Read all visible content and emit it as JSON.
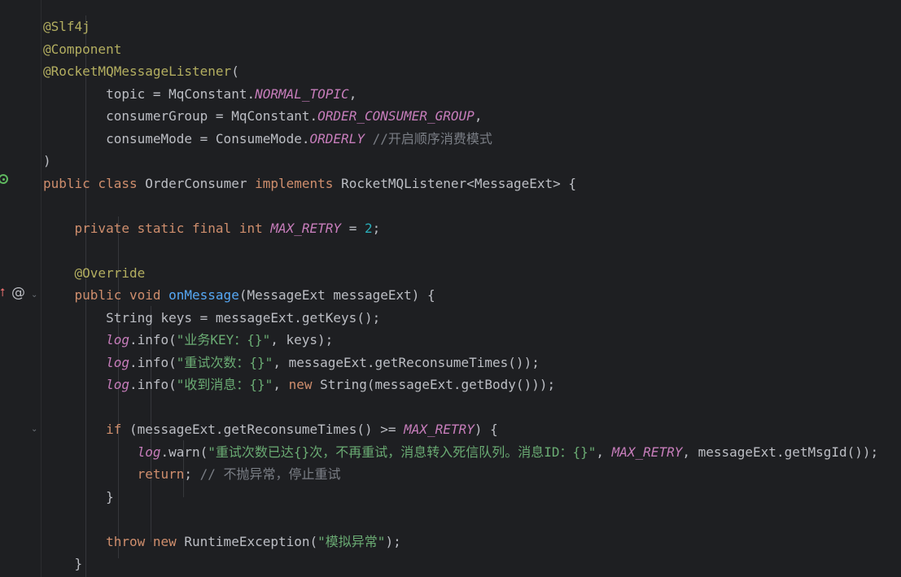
{
  "code": {
    "lines": [
      {
        "tokens": [
          {
            "c": "ann",
            "t": "@Slf4j"
          }
        ]
      },
      {
        "tokens": [
          {
            "c": "ann",
            "t": "@Component"
          }
        ]
      },
      {
        "tokens": [
          {
            "c": "ann",
            "t": "@RocketMQMessageListener"
          },
          {
            "c": "plain",
            "t": "("
          }
        ]
      },
      {
        "tokens": [
          {
            "c": "plain",
            "t": "        topic = MqConstant."
          },
          {
            "c": "const",
            "t": "NORMAL_TOPIC"
          },
          {
            "c": "plain",
            "t": ","
          }
        ]
      },
      {
        "tokens": [
          {
            "c": "plain",
            "t": "        consumerGroup = MqConstant."
          },
          {
            "c": "const",
            "t": "ORDER_CONSUMER_GROUP"
          },
          {
            "c": "plain",
            "t": ","
          }
        ]
      },
      {
        "tokens": [
          {
            "c": "plain",
            "t": "        consumeMode = ConsumeMode."
          },
          {
            "c": "const",
            "t": "ORDERLY"
          },
          {
            "c": "plain",
            "t": " "
          },
          {
            "c": "cmt",
            "t": "//开启顺序消费模式"
          }
        ]
      },
      {
        "tokens": [
          {
            "c": "plain",
            "t": ")"
          }
        ]
      },
      {
        "tokens": [
          {
            "c": "kw",
            "t": "public class "
          },
          {
            "c": "plain",
            "t": "OrderConsumer "
          },
          {
            "c": "kw",
            "t": "implements "
          },
          {
            "c": "plain",
            "t": "RocketMQListener<MessageExt> {"
          }
        ]
      },
      {
        "tokens": []
      },
      {
        "tokens": [
          {
            "c": "plain",
            "t": "    "
          },
          {
            "c": "kw",
            "t": "private static final int "
          },
          {
            "c": "const",
            "t": "MAX_RETRY"
          },
          {
            "c": "plain",
            "t": " = "
          },
          {
            "c": "num",
            "t": "2"
          },
          {
            "c": "plain",
            "t": ";"
          }
        ]
      },
      {
        "tokens": []
      },
      {
        "tokens": [
          {
            "c": "plain",
            "t": "    "
          },
          {
            "c": "ann",
            "t": "@Override"
          }
        ]
      },
      {
        "tokens": [
          {
            "c": "plain",
            "t": "    "
          },
          {
            "c": "kw",
            "t": "public void "
          },
          {
            "c": "fn",
            "t": "onMessage"
          },
          {
            "c": "plain",
            "t": "(MessageExt messageExt) {"
          }
        ]
      },
      {
        "tokens": [
          {
            "c": "plain",
            "t": "        String keys = messageExt.getKeys();"
          }
        ]
      },
      {
        "tokens": [
          {
            "c": "plain",
            "t": "        "
          },
          {
            "c": "field",
            "t": "log"
          },
          {
            "c": "plain",
            "t": ".info("
          },
          {
            "c": "str",
            "t": "\"业务KEY：{}\""
          },
          {
            "c": "plain",
            "t": ", keys);"
          }
        ]
      },
      {
        "tokens": [
          {
            "c": "plain",
            "t": "        "
          },
          {
            "c": "field",
            "t": "log"
          },
          {
            "c": "plain",
            "t": ".info("
          },
          {
            "c": "str",
            "t": "\"重试次数：{}\""
          },
          {
            "c": "plain",
            "t": ", messageExt.getReconsumeTimes());"
          }
        ]
      },
      {
        "tokens": [
          {
            "c": "plain",
            "t": "        "
          },
          {
            "c": "field",
            "t": "log"
          },
          {
            "c": "plain",
            "t": ".info("
          },
          {
            "c": "str",
            "t": "\"收到消息：{}\""
          },
          {
            "c": "plain",
            "t": ", "
          },
          {
            "c": "kw",
            "t": "new "
          },
          {
            "c": "plain",
            "t": "String(messageExt.getBody()));"
          }
        ]
      },
      {
        "tokens": []
      },
      {
        "tokens": [
          {
            "c": "plain",
            "t": "        "
          },
          {
            "c": "kw",
            "t": "if "
          },
          {
            "c": "plain",
            "t": "(messageExt.getReconsumeTimes() >= "
          },
          {
            "c": "const",
            "t": "MAX_RETRY"
          },
          {
            "c": "plain",
            "t": ") {"
          }
        ]
      },
      {
        "tokens": [
          {
            "c": "plain",
            "t": "            "
          },
          {
            "c": "field",
            "t": "log"
          },
          {
            "c": "plain",
            "t": ".warn("
          },
          {
            "c": "str",
            "t": "\"重试次数已达{}次，不再重试，消息转入死信队列。消息ID：{}\""
          },
          {
            "c": "plain",
            "t": ", "
          },
          {
            "c": "const",
            "t": "MAX_RETRY"
          },
          {
            "c": "plain",
            "t": ", messageExt.getMsgId());"
          }
        ]
      },
      {
        "tokens": [
          {
            "c": "plain",
            "t": "            "
          },
          {
            "c": "kw",
            "t": "return"
          },
          {
            "c": "plain",
            "t": "; "
          },
          {
            "c": "cmt",
            "t": "// 不抛异常，停止重试"
          }
        ]
      },
      {
        "tokens": [
          {
            "c": "plain",
            "t": "        }"
          }
        ]
      },
      {
        "tokens": []
      },
      {
        "tokens": [
          {
            "c": "plain",
            "t": "        "
          },
          {
            "c": "kw",
            "t": "throw new "
          },
          {
            "c": "plain",
            "t": "RuntimeException("
          },
          {
            "c": "str",
            "t": "\"模拟异常\""
          },
          {
            "c": "plain",
            "t": ");"
          }
        ]
      },
      {
        "tokens": [
          {
            "c": "plain",
            "t": "    }"
          }
        ]
      }
    ]
  },
  "gutter": {
    "bean_icon": "spring-bean-gutter-icon",
    "override_icon": "implements-method-icon",
    "at_icon": "at-annotation-icon",
    "override_symbol": "⭡",
    "at_symbol": "@",
    "fold_symbol": "⌄"
  },
  "colors": {
    "background": "#1e1f22",
    "keyword": "#cf8e6d",
    "annotation": "#b3ae60",
    "constant": "#c77dbb",
    "string": "#6aab73",
    "number": "#2aacb8",
    "comment": "#7a7e85",
    "function": "#56a8f5",
    "text": "#bcbec4"
  }
}
